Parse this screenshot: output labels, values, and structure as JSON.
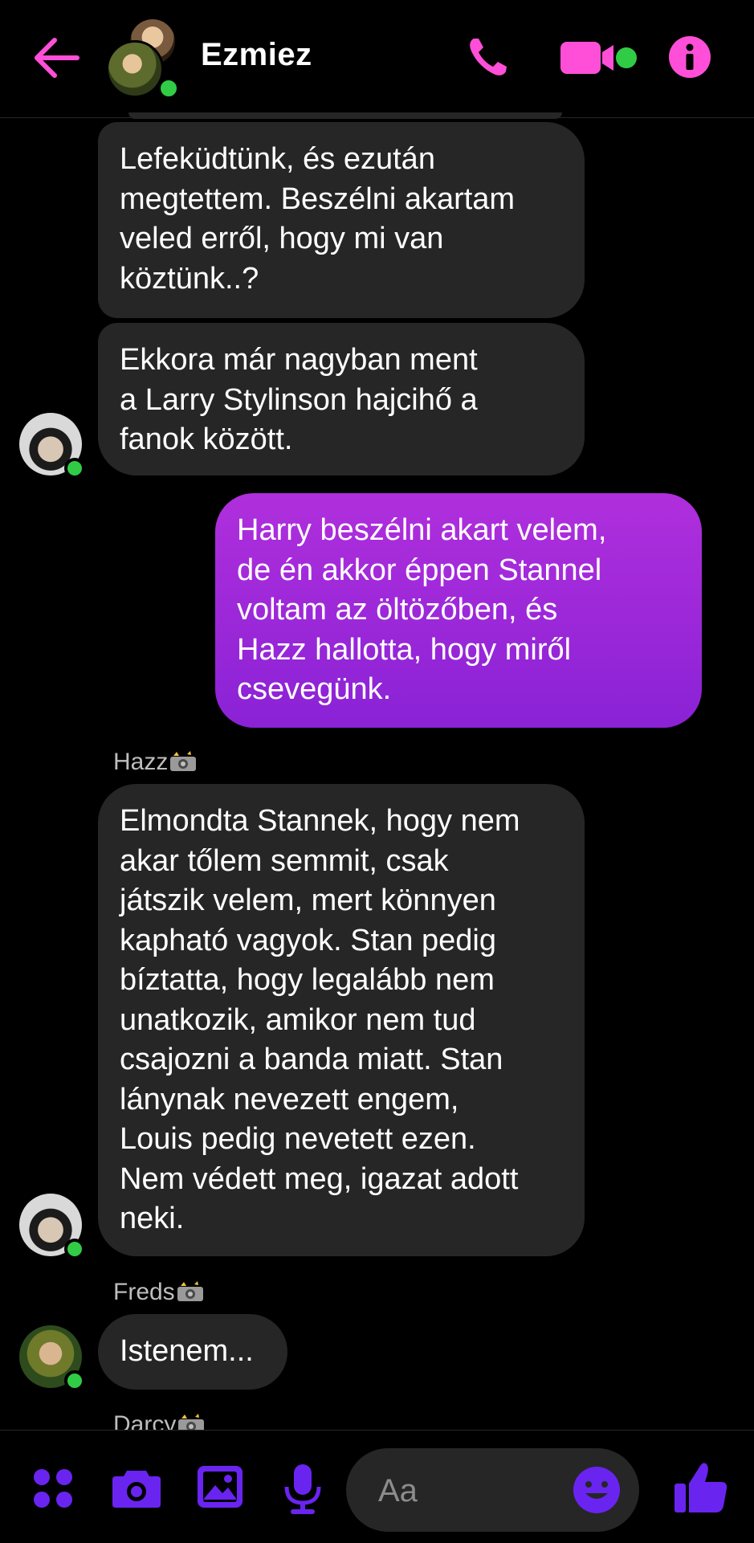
{
  "header": {
    "title": "Ezmiez",
    "icons": {
      "back": "arrow-left-icon",
      "call": "phone-icon",
      "video": "video-camera-icon",
      "info": "info-icon"
    },
    "accent_color": "#ff4fd8"
  },
  "messages": [
    {
      "side": "in",
      "text": "Lefeküdtünk, és ezután\nmegtettem. Beszélni akartam\nveled erről, hogy mi van\nköztünk..?"
    },
    {
      "side": "in",
      "text": "Ekkora már nagyban ment\na Larry Stylinson hajcihő a\nfanok között."
    },
    {
      "side": "out",
      "text": "Harry beszélni akart velem,\nde én akkor éppen Stannel\nvoltam az öltözőben, és\nHazz hallotta, hogy miről\ncsevegünk."
    },
    {
      "side": "in",
      "sender": "Hazz",
      "text": "Elmondta Stannek, hogy nem\nakar tőlem semmit, csak\njátszik velem, mert könnyen\nkapható vagyok. Stan pedig\nbíztatta, hogy legalább nem\nunatkozik, amikor nem tud\ncsajozni a banda miatt. Stan\nlánynak nevezett engem,\nLouis pedig nevetett ezen.\nNem védett meg, igazat adott\nneki."
    },
    {
      "side": "in",
      "sender": "Freds",
      "text": "Istenem..."
    }
  ],
  "partial_sender": "Darcy",
  "sender_emoji": "camera-flash-emoji",
  "composer": {
    "placeholder": "Aa",
    "icons": [
      "apps-icon",
      "camera-icon",
      "gallery-icon",
      "microphone-icon",
      "emoji-icon",
      "thumbs-up-icon"
    ],
    "accent_color": "#6a24f0"
  },
  "colors": {
    "incoming_bubble": "#262626",
    "outgoing_bubble_top": "#b02fdc",
    "outgoing_bubble_bottom": "#8a22d6",
    "online": "#31cc46"
  }
}
